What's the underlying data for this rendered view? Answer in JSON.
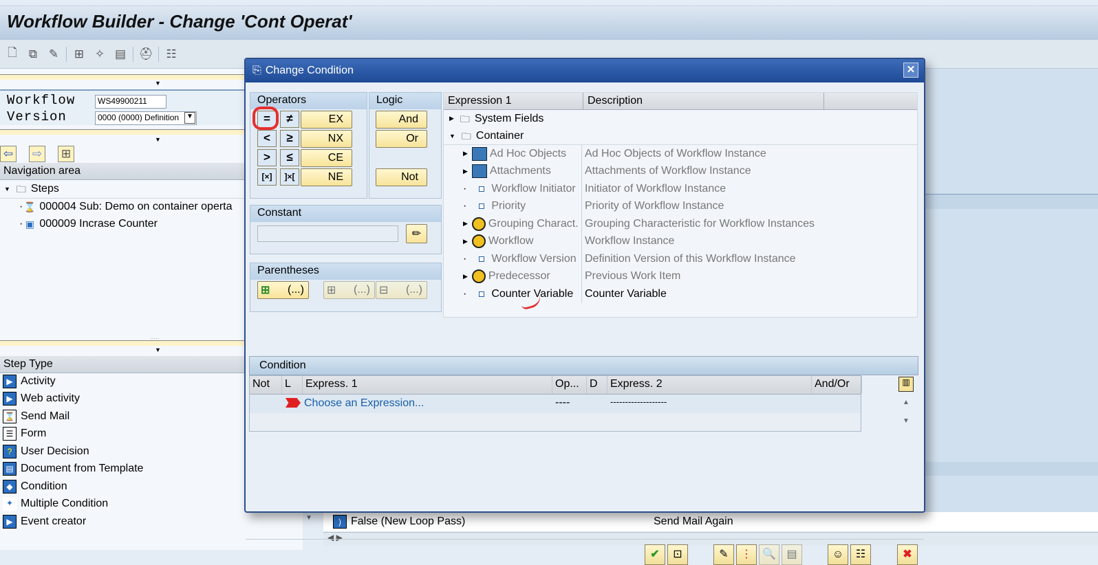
{
  "window": {
    "title": "Workflow Builder - Change 'Cont Operat'"
  },
  "toolbar": {
    "icons": [
      "new-icon",
      "copy-icon",
      "edit-icon",
      "hierarchy-icon",
      "wizard-icon",
      "print-icon",
      "hat-icon",
      "list-icon"
    ]
  },
  "header": {
    "workflow_label": "Workflow",
    "workflow_value": "WS49900211",
    "version_label": "Version",
    "version_value": "0000 (0000) Definition"
  },
  "navigation": {
    "title": "Navigation area",
    "root": "Steps",
    "items": [
      "000004 Sub: Demo on container operta",
      "000009 Incrase Counter"
    ]
  },
  "step_types": {
    "title": "Step Type",
    "items": [
      "Activity",
      "Web activity",
      "Send Mail",
      "Form",
      "User Decision",
      "Document from Template",
      "Condition",
      "Multiple Condition",
      "Event creator"
    ]
  },
  "background": {
    "row_label": "False (New Loop Pass)",
    "row_value": "Send Mail Again"
  },
  "dialog": {
    "title": "Change Condition",
    "operators": {
      "title": "Operators",
      "symbols": [
        "=",
        "≠",
        "<",
        "≥",
        ">",
        "≤",
        "[×]",
        "]×["
      ],
      "codes": [
        "EX",
        "NX",
        "CE",
        "NE"
      ]
    },
    "logic": {
      "title": "Logic",
      "and": "And",
      "or": "Or",
      "not": "Not"
    },
    "constant": {
      "title": "Constant",
      "value": ""
    },
    "parentheses": {
      "title": "Parentheses",
      "insert": "(...)",
      "add": "(...)",
      "remove": "(...)"
    },
    "expression_tree": {
      "col1": "Expression 1",
      "col2": "Description",
      "folders": [
        "System Fields",
        "Container"
      ],
      "items": [
        {
          "name": "Ad Hoc Objects",
          "desc": "Ad Hoc Objects of Workflow Instance",
          "type": "table"
        },
        {
          "name": "Attachments",
          "desc": "Attachments of Workflow Instance",
          "type": "table"
        },
        {
          "name": "Workflow Initiator",
          "desc": "Initiator of Workflow Instance",
          "type": "field"
        },
        {
          "name": "Priority",
          "desc": "Priority of Workflow Instance",
          "type": "field"
        },
        {
          "name": "Grouping Charact.",
          "desc": "Grouping Characteristic for Workflow Instances",
          "type": "object"
        },
        {
          "name": "Workflow",
          "desc": "Workflow Instance",
          "type": "object"
        },
        {
          "name": "Workflow Version",
          "desc": "Definition Version of this Workflow Instance",
          "type": "field"
        },
        {
          "name": "Predecessor",
          "desc": "Previous Work Item",
          "type": "object"
        },
        {
          "name": "Counter Variable",
          "desc": "Counter Variable",
          "type": "field"
        }
      ]
    },
    "condition": {
      "title": "Condition",
      "columns": [
        "Not",
        "L",
        "Express. 1",
        "Op...",
        "D",
        "Express. 2",
        "And/Or"
      ],
      "rows": [
        {
          "not": "",
          "expr1": "Choose an Expression...",
          "op": "----",
          "d": "",
          "expr2": "-------------------",
          "andor": ""
        }
      ]
    }
  },
  "colors": {
    "dialog_title": "#1e4a96",
    "button": "#f7e49a",
    "link": "#1a5fa8",
    "annotation": "#e53030"
  }
}
